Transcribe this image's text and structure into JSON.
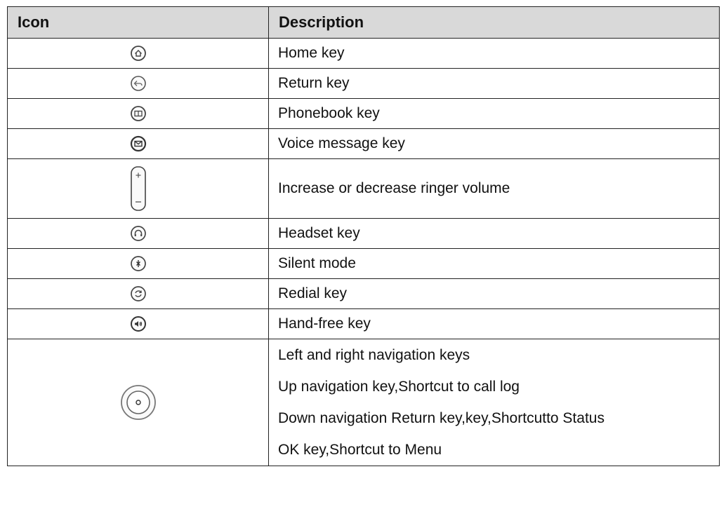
{
  "table": {
    "headers": {
      "icon": "Icon",
      "description": "Description"
    },
    "rows": [
      {
        "icon": "home-key-icon",
        "description": "Home key"
      },
      {
        "icon": "return-key-icon",
        "description": "Return key"
      },
      {
        "icon": "phonebook-key-icon",
        "description": "Phonebook key"
      },
      {
        "icon": "voice-message-key-icon",
        "description": "Voice message key"
      },
      {
        "icon": "volume-key-icon",
        "description": "Increase or decrease ringer volume"
      },
      {
        "icon": "headset-key-icon",
        "description": "Headset key"
      },
      {
        "icon": "silent-mode-icon",
        "description": "Silent mode"
      },
      {
        "icon": "redial-key-icon",
        "description": "Redial key"
      },
      {
        "icon": "hand-free-key-icon",
        "description": "Hand-free key"
      },
      {
        "icon": "navigation-key-icon",
        "lines": [
          "Left and right navigation keys",
          "Up navigation key,Shortcut to call log",
          "Down navigation Return key,key,Shortcutto Status",
          "OK key,Shortcut to Menu"
        ]
      }
    ]
  },
  "colors": {
    "header_bg": "#d9d9d9",
    "border": "#222222",
    "icon_stroke": "#444444"
  }
}
